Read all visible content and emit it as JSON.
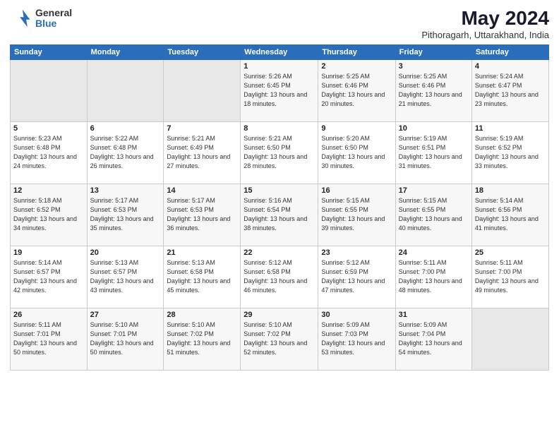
{
  "logo": {
    "general": "General",
    "blue": "Blue"
  },
  "header": {
    "title": "May 2024",
    "subtitle": "Pithoragarh, Uttarakhand, India"
  },
  "days_of_week": [
    "Sunday",
    "Monday",
    "Tuesday",
    "Wednesday",
    "Thursday",
    "Friday",
    "Saturday"
  ],
  "weeks": [
    [
      {
        "day": "",
        "info": ""
      },
      {
        "day": "",
        "info": ""
      },
      {
        "day": "",
        "info": ""
      },
      {
        "day": "1",
        "info": "Sunrise: 5:26 AM\nSunset: 6:45 PM\nDaylight: 13 hours and 18 minutes."
      },
      {
        "day": "2",
        "info": "Sunrise: 5:25 AM\nSunset: 6:46 PM\nDaylight: 13 hours and 20 minutes."
      },
      {
        "day": "3",
        "info": "Sunrise: 5:25 AM\nSunset: 6:46 PM\nDaylight: 13 hours and 21 minutes."
      },
      {
        "day": "4",
        "info": "Sunrise: 5:24 AM\nSunset: 6:47 PM\nDaylight: 13 hours and 23 minutes."
      }
    ],
    [
      {
        "day": "5",
        "info": "Sunrise: 5:23 AM\nSunset: 6:48 PM\nDaylight: 13 hours and 24 minutes."
      },
      {
        "day": "6",
        "info": "Sunrise: 5:22 AM\nSunset: 6:48 PM\nDaylight: 13 hours and 26 minutes."
      },
      {
        "day": "7",
        "info": "Sunrise: 5:21 AM\nSunset: 6:49 PM\nDaylight: 13 hours and 27 minutes."
      },
      {
        "day": "8",
        "info": "Sunrise: 5:21 AM\nSunset: 6:50 PM\nDaylight: 13 hours and 28 minutes."
      },
      {
        "day": "9",
        "info": "Sunrise: 5:20 AM\nSunset: 6:50 PM\nDaylight: 13 hours and 30 minutes."
      },
      {
        "day": "10",
        "info": "Sunrise: 5:19 AM\nSunset: 6:51 PM\nDaylight: 13 hours and 31 minutes."
      },
      {
        "day": "11",
        "info": "Sunrise: 5:19 AM\nSunset: 6:52 PM\nDaylight: 13 hours and 33 minutes."
      }
    ],
    [
      {
        "day": "12",
        "info": "Sunrise: 5:18 AM\nSunset: 6:52 PM\nDaylight: 13 hours and 34 minutes."
      },
      {
        "day": "13",
        "info": "Sunrise: 5:17 AM\nSunset: 6:53 PM\nDaylight: 13 hours and 35 minutes."
      },
      {
        "day": "14",
        "info": "Sunrise: 5:17 AM\nSunset: 6:53 PM\nDaylight: 13 hours and 36 minutes."
      },
      {
        "day": "15",
        "info": "Sunrise: 5:16 AM\nSunset: 6:54 PM\nDaylight: 13 hours and 38 minutes."
      },
      {
        "day": "16",
        "info": "Sunrise: 5:15 AM\nSunset: 6:55 PM\nDaylight: 13 hours and 39 minutes."
      },
      {
        "day": "17",
        "info": "Sunrise: 5:15 AM\nSunset: 6:55 PM\nDaylight: 13 hours and 40 minutes."
      },
      {
        "day": "18",
        "info": "Sunrise: 5:14 AM\nSunset: 6:56 PM\nDaylight: 13 hours and 41 minutes."
      }
    ],
    [
      {
        "day": "19",
        "info": "Sunrise: 5:14 AM\nSunset: 6:57 PM\nDaylight: 13 hours and 42 minutes."
      },
      {
        "day": "20",
        "info": "Sunrise: 5:13 AM\nSunset: 6:57 PM\nDaylight: 13 hours and 43 minutes."
      },
      {
        "day": "21",
        "info": "Sunrise: 5:13 AM\nSunset: 6:58 PM\nDaylight: 13 hours and 45 minutes."
      },
      {
        "day": "22",
        "info": "Sunrise: 5:12 AM\nSunset: 6:58 PM\nDaylight: 13 hours and 46 minutes."
      },
      {
        "day": "23",
        "info": "Sunrise: 5:12 AM\nSunset: 6:59 PM\nDaylight: 13 hours and 47 minutes."
      },
      {
        "day": "24",
        "info": "Sunrise: 5:11 AM\nSunset: 7:00 PM\nDaylight: 13 hours and 48 minutes."
      },
      {
        "day": "25",
        "info": "Sunrise: 5:11 AM\nSunset: 7:00 PM\nDaylight: 13 hours and 49 minutes."
      }
    ],
    [
      {
        "day": "26",
        "info": "Sunrise: 5:11 AM\nSunset: 7:01 PM\nDaylight: 13 hours and 50 minutes."
      },
      {
        "day": "27",
        "info": "Sunrise: 5:10 AM\nSunset: 7:01 PM\nDaylight: 13 hours and 50 minutes."
      },
      {
        "day": "28",
        "info": "Sunrise: 5:10 AM\nSunset: 7:02 PM\nDaylight: 13 hours and 51 minutes."
      },
      {
        "day": "29",
        "info": "Sunrise: 5:10 AM\nSunset: 7:02 PM\nDaylight: 13 hours and 52 minutes."
      },
      {
        "day": "30",
        "info": "Sunrise: 5:09 AM\nSunset: 7:03 PM\nDaylight: 13 hours and 53 minutes."
      },
      {
        "day": "31",
        "info": "Sunrise: 5:09 AM\nSunset: 7:04 PM\nDaylight: 13 hours and 54 minutes."
      },
      {
        "day": "",
        "info": ""
      }
    ]
  ]
}
